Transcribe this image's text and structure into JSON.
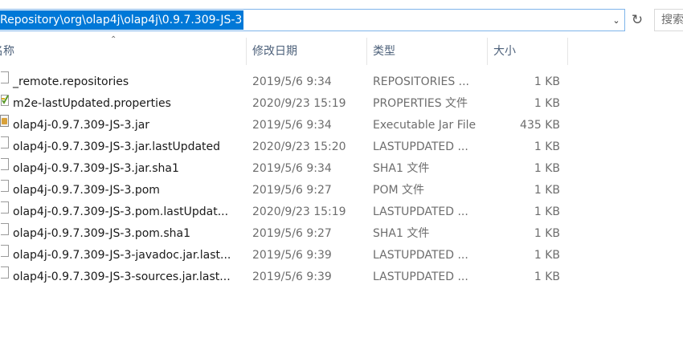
{
  "address": {
    "path": "Repository\\org\\olap4j\\olap4j\\0.9.7.309-JS-3"
  },
  "search": {
    "label": "搜索"
  },
  "columns": {
    "name": "名称",
    "date": "修改日期",
    "type": "类型",
    "size": "大小"
  },
  "files": [
    {
      "name": "_remote.repositories",
      "date": "2019/5/6 9:34",
      "type": "REPOSITORIES ...",
      "size": "1 KB",
      "icon": "file-icon"
    },
    {
      "name": "m2e-lastUpdated.properties",
      "date": "2020/9/23 15:19",
      "type": "PROPERTIES 文件",
      "size": "1 KB",
      "icon": "properties-file-icon"
    },
    {
      "name": "olap4j-0.9.7.309-JS-3.jar",
      "date": "2019/5/6 9:34",
      "type": "Executable Jar File",
      "size": "435 KB",
      "icon": "jar-file-icon"
    },
    {
      "name": "olap4j-0.9.7.309-JS-3.jar.lastUpdated",
      "date": "2020/9/23 15:20",
      "type": "LASTUPDATED ...",
      "size": "1 KB",
      "icon": "file-icon"
    },
    {
      "name": "olap4j-0.9.7.309-JS-3.jar.sha1",
      "date": "2019/5/6 9:34",
      "type": "SHA1 文件",
      "size": "1 KB",
      "icon": "file-icon"
    },
    {
      "name": "olap4j-0.9.7.309-JS-3.pom",
      "date": "2019/5/6 9:27",
      "type": "POM 文件",
      "size": "1 KB",
      "icon": "file-icon"
    },
    {
      "name": "olap4j-0.9.7.309-JS-3.pom.lastUpdat...",
      "date": "2020/9/23 15:19",
      "type": "LASTUPDATED ...",
      "size": "1 KB",
      "icon": "file-icon"
    },
    {
      "name": "olap4j-0.9.7.309-JS-3.pom.sha1",
      "date": "2019/5/6 9:27",
      "type": "SHA1 文件",
      "size": "1 KB",
      "icon": "file-icon"
    },
    {
      "name": "olap4j-0.9.7.309-JS-3-javadoc.jar.last...",
      "date": "2019/5/6 9:39",
      "type": "LASTUPDATED ...",
      "size": "1 KB",
      "icon": "file-icon"
    },
    {
      "name": "olap4j-0.9.7.309-JS-3-sources.jar.last...",
      "date": "2019/5/6 9:39",
      "type": "LASTUPDATED ...",
      "size": "1 KB",
      "icon": "file-icon"
    }
  ],
  "colors": {
    "selection": "#0078d7",
    "header_text": "#4c607a",
    "secondary_text": "#6d6d6d"
  }
}
